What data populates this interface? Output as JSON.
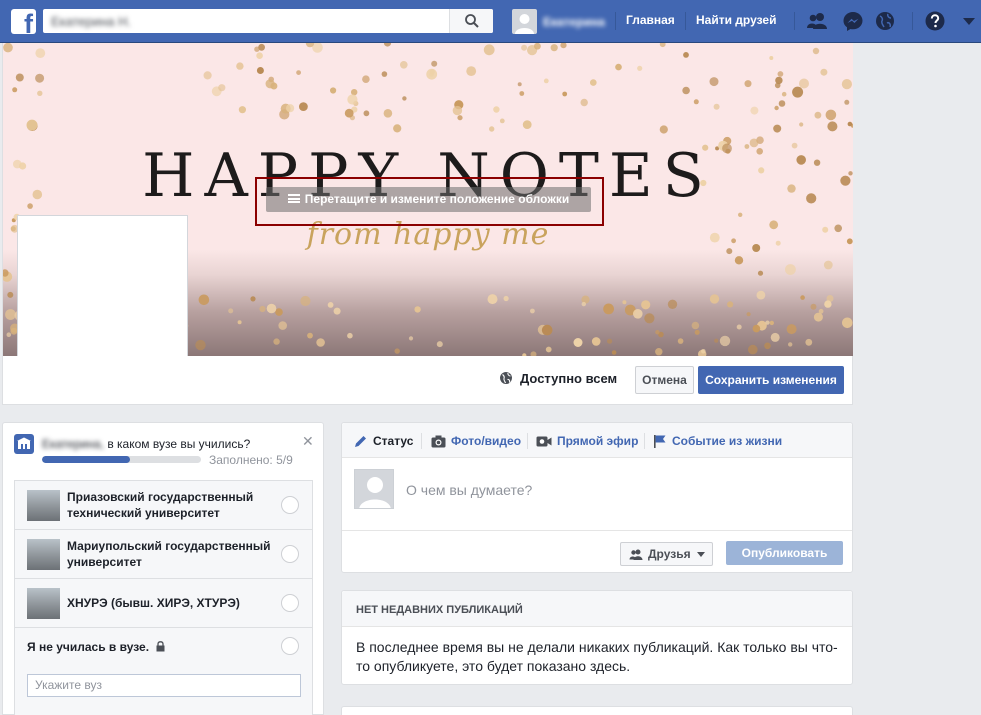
{
  "topbar": {
    "brand_color": "#4267b2",
    "search_value": "Екатерина Н.",
    "user_name": "Екатерина",
    "nav": {
      "home": "Главная",
      "find_friends": "Найти друзей"
    },
    "icons": [
      "friend-requests-icon",
      "messenger-icon",
      "notifications-globe-icon",
      "help-icon",
      "account-menu-chevron-icon"
    ]
  },
  "cover": {
    "title": "HAPPY NOTES",
    "subtitle": "from happy me",
    "drag_hint": "Перетащите и измените положение обложки",
    "visibility": "Доступно всем",
    "cancel_label": "Отмена",
    "save_label": "Сохранить изменения"
  },
  "education": {
    "question_name": "Екатерина,",
    "question_text": " в каком вузе вы учились?",
    "progress_label": "Заполнено: 5/9",
    "progress_fraction": 0.556,
    "items": [
      {
        "name": "Приазовский государственный технический университет"
      },
      {
        "name": "Мариупольский государственный университет"
      },
      {
        "name": "ХНУРЭ (бывш. ХИРЭ, ХТУРЭ)"
      }
    ],
    "no_school": "Я не училась в вузе.",
    "input_placeholder": "Укажите вуз"
  },
  "composer": {
    "tabs": [
      "Статус",
      "Фото/видео",
      "Прямой эфир",
      "Событие из жизни"
    ],
    "placeholder": "О чем вы думаете?",
    "audience": "Друзья",
    "publish": "Опубликовать"
  },
  "recent": {
    "title": "НЕТ НЕДАВНИХ ПУБЛИКАЦИЙ",
    "body": "В последнее время вы не делали никаких публикаций. Как только вы что-то опубликуете, это будет показано здесь."
  }
}
